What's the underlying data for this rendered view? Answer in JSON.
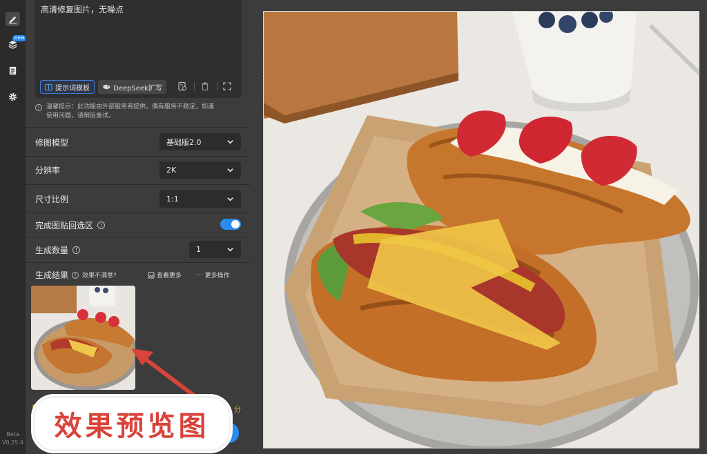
{
  "prompt": {
    "text": "高清修复图片，无噪点",
    "template_button": "提示词模板",
    "deepseek_button": "DeepSeek扩写"
  },
  "tip": {
    "line1": "温馨提示：此功能由外部服务商提供，偶有服务不稳定，如遇",
    "line2": "使用问题，请稍后重试。"
  },
  "settings": {
    "model_label": "修图模型",
    "model_value": "基础版2.0",
    "resolution_label": "分辨率",
    "resolution_value": "2K",
    "ratio_label": "尺寸比例",
    "ratio_value": "1:1",
    "paste_back_label": "完成图贴回选区",
    "paste_back_on": true,
    "count_label": "生成数量",
    "count_value": "1"
  },
  "result": {
    "label": "生成结果",
    "unsatisfied": "效果不满意?",
    "view_more": "查看更多",
    "more_actions": "更多操作"
  },
  "annotation": {
    "text": "效果预览图",
    "color": "#d8433a"
  },
  "footer": {
    "badge_new": "new",
    "beta": "Beta",
    "version": "V0.25.4",
    "partial_text": "分"
  },
  "colors": {
    "accent": "#2a8bf2",
    "panel_bg": "#3c3c3c",
    "strip_bg": "#2b2b2b"
  }
}
